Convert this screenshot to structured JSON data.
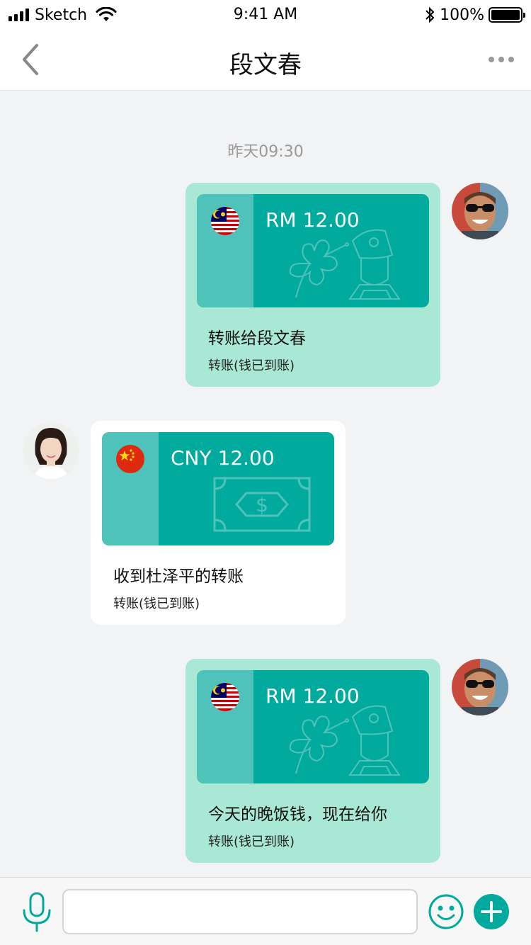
{
  "status_bar": {
    "carrier": "Sketch",
    "time": "9:41 AM",
    "battery": "100%",
    "battery_level": 1.0
  },
  "header": {
    "title": "段文春",
    "back_icon": "chevron-left-icon",
    "more_icon": "more-horizontal-icon"
  },
  "chat": {
    "timestamp": "昨天09:30",
    "messages": [
      {
        "sender": "me",
        "flag": "malaysia-flag-icon",
        "amount": "RM 12.00",
        "title": "转账给段文春",
        "status": "转账(钱已到账)"
      },
      {
        "sender": "other",
        "flag": "china-flag-icon",
        "amount": "CNY 12.00",
        "title": "收到杜泽平的转账",
        "status": "转账(钱已到账)"
      },
      {
        "sender": "me",
        "flag": "malaysia-flag-icon",
        "amount": "RM 12.00",
        "title": "今天的晚饭钱，现在给你",
        "status": "转账(钱已到账)"
      }
    ]
  },
  "input_bar": {
    "value": "",
    "placeholder": "",
    "mic_icon": "microphone-icon",
    "emoji_icon": "smiley-icon",
    "plus_icon": "plus-circle-icon"
  },
  "colors": {
    "accent": "#00ab9d",
    "card_strip": "#4fc3b9",
    "my_bubble": "#a9e8d5",
    "their_bubble": "#ffffff",
    "background": "#f2f3f5"
  }
}
